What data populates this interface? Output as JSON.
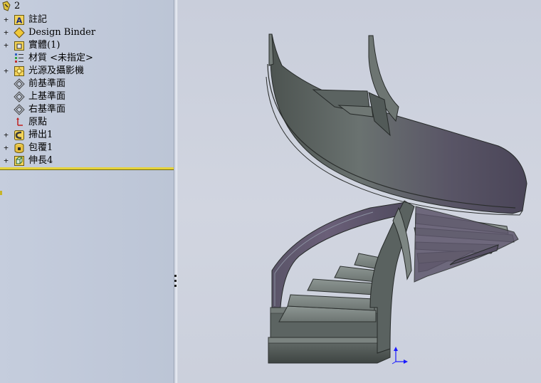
{
  "tree": {
    "part_name": "2",
    "items": [
      {
        "label": "註記",
        "icon": "annotation-icon",
        "expandable": true
      },
      {
        "label": "Design Binder",
        "icon": "design-binder-icon",
        "expandable": true
      },
      {
        "label": "實體(1)",
        "icon": "solid-bodies-icon",
        "expandable": true
      },
      {
        "label": "材質 <未指定>",
        "icon": "material-icon",
        "expandable": false
      },
      {
        "label": "光源及攝影機",
        "icon": "lights-cameras-icon",
        "expandable": true
      },
      {
        "label": "前基準面",
        "icon": "plane-icon",
        "expandable": false
      },
      {
        "label": "上基準面",
        "icon": "plane-icon",
        "expandable": false
      },
      {
        "label": "右基準面",
        "icon": "plane-icon",
        "expandable": false
      },
      {
        "label": "原點",
        "icon": "origin-icon",
        "expandable": false
      },
      {
        "label": "掃出1",
        "icon": "sweep-icon",
        "expandable": true
      },
      {
        "label": "包覆1",
        "icon": "wrap-icon",
        "expandable": true
      },
      {
        "label": "伸長4",
        "icon": "extrude-icon",
        "expandable": true
      }
    ],
    "expander_symbol": "+"
  },
  "colors": {
    "panel_bg": "#c2cadb",
    "viewport_bg": "#cdd1dd",
    "rollback_bar": "#e5d23a",
    "model_gray": "#5f6764",
    "model_purple": "#615a70",
    "axis_blue": "#1a1aff"
  }
}
